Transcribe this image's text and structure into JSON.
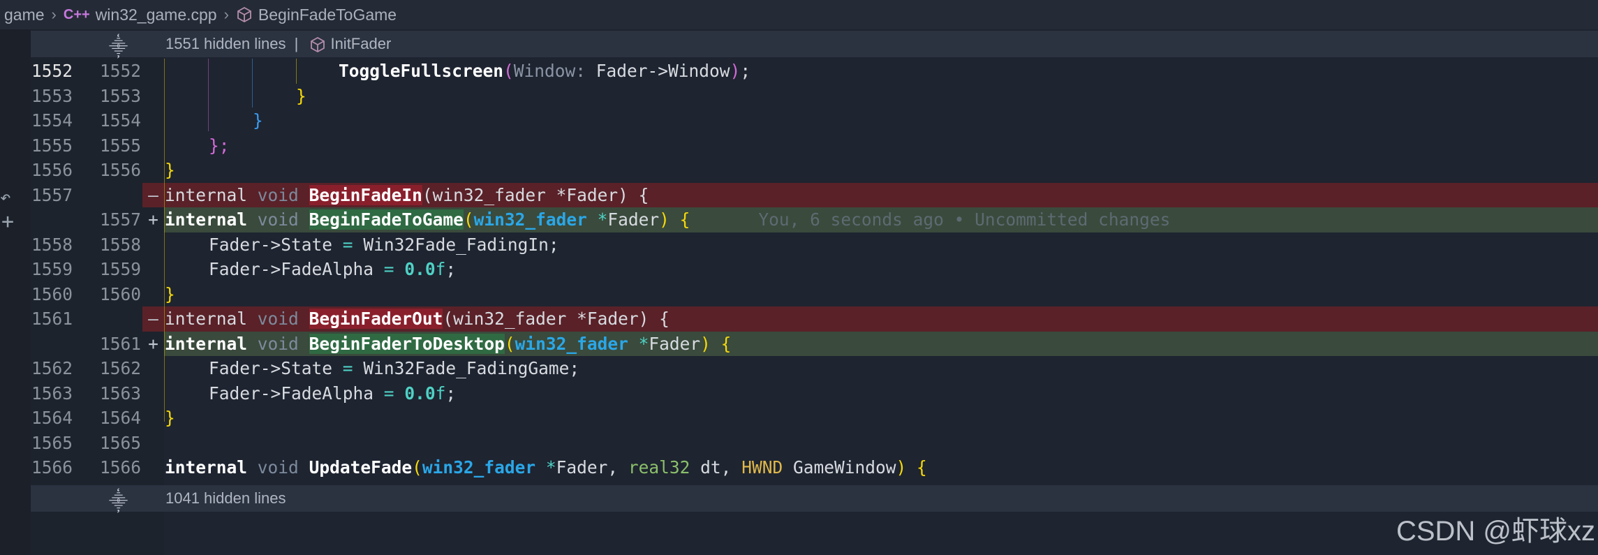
{
  "breadcrumb": {
    "folder": "game",
    "file": "win32_game.cpp",
    "file_icon": "C++",
    "symbol": "BeginFadeToGame"
  },
  "hidden_top": {
    "text": "1551 hidden lines",
    "divider": "|",
    "symbol": "InitFader"
  },
  "hidden_bottom": {
    "text": "1041 hidden lines"
  },
  "lines": [
    {
      "old": "1552",
      "new": "1552"
    },
    {
      "old": "1553",
      "new": "1553"
    },
    {
      "old": "1554",
      "new": "1554"
    },
    {
      "old": "1555",
      "new": "1555"
    },
    {
      "old": "1556",
      "new": "1556"
    },
    {
      "old": "1557",
      "new": "",
      "mark": "—"
    },
    {
      "old": "",
      "new": "1557",
      "mark": "+"
    },
    {
      "old": "1558",
      "new": "1558"
    },
    {
      "old": "1559",
      "new": "1559"
    },
    {
      "old": "1560",
      "new": "1560"
    },
    {
      "old": "1561",
      "new": "",
      "mark": "—"
    },
    {
      "old": "",
      "new": "1561",
      "mark": "+"
    },
    {
      "old": "1562",
      "new": "1562"
    },
    {
      "old": "1563",
      "new": "1563"
    },
    {
      "old": "1564",
      "new": "1564"
    },
    {
      "old": "1565",
      "new": "1565"
    },
    {
      "old": "1566",
      "new": "1566"
    }
  ],
  "code": {
    "l1552": {
      "fn": "ToggleFullscreen",
      "hint": "Window:",
      "arg": " Fader->Window",
      "end": ";"
    },
    "l1553": "}",
    "l1554": "}",
    "l1555": "};",
    "l1556": "}",
    "l1557_removed": {
      "kw": "internal",
      "void": "void",
      "fn": "BeginFadeIn",
      "rest": "(win32_fader *Fader) {"
    },
    "l1557_added": {
      "kw": "internal",
      "void": "void",
      "fn": "BeginFadeToGame",
      "type": "win32_fader",
      "ptr": "*",
      "param": "Fader",
      "end": ") {",
      "blame": "You, 6 seconds ago • Uncommitted changes"
    },
    "l1558": {
      "lhs": "Fader->State",
      "eq": "=",
      "rhs": "Win32Fade_FadingIn;"
    },
    "l1559": {
      "lhs": "Fader->FadeAlpha",
      "eq": "=",
      "num": "0.0",
      "suffix": "f",
      "end": ";"
    },
    "l1560": "}",
    "l1561_removed": {
      "kw": "internal",
      "void": "void",
      "fn": "BeginFaderOut",
      "rest": "(win32_fader *Fader) {"
    },
    "l1561_added": {
      "kw": "internal",
      "void": "void",
      "fn": "BeginFaderToDesktop",
      "type": "win32_fader",
      "ptr": "*",
      "param": "Fader",
      "end": ") {"
    },
    "l1562": {
      "lhs": "Fader->State",
      "eq": "=",
      "rhs": "Win32Fade_FadingGame;"
    },
    "l1563": {
      "lhs": "Fader->FadeAlpha",
      "eq": "=",
      "num": "0.0",
      "suffix": "f",
      "end": ";"
    },
    "l1564": "}",
    "l1566": {
      "kw": "internal",
      "void": "void",
      "fn": "UpdateFade",
      "type": "win32_fader",
      "ptr": "*",
      "p1": "Fader, ",
      "real": "real32",
      "p2": " dt, ",
      "hwnd": "HWND",
      "p3": " GameWindow",
      "end": ") {"
    }
  },
  "watermark": "CSDN @虾球xz",
  "colors": {
    "removed_bg": "#5a2128",
    "added_bg": "#3a4a3c",
    "editor_bg": "#1e2430"
  }
}
